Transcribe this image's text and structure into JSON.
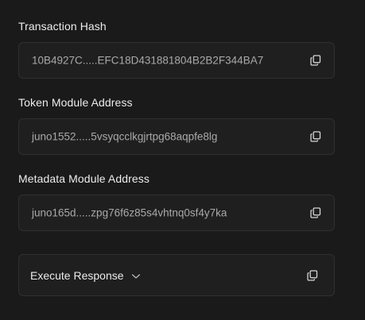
{
  "fields": [
    {
      "label": "Transaction Hash",
      "value": "10B4927C.....EFC18D431881804B2B2F344BA7",
      "copy_icon": "copy-icon"
    },
    {
      "label": "Token Module Address",
      "value": "juno1552.....5vsyqcclkgjrtpg68aqpfe8lg",
      "copy_icon": "copy-icon"
    },
    {
      "label": "Metadata Module Address",
      "value": "juno165d.....zpg76f6z85s4vhtnq0sf4y7ka",
      "copy_icon": "copy-icon"
    }
  ],
  "execute": {
    "label": "Execute Response",
    "chevron_icon": "chevron-down-icon",
    "copy_icon": "copy-icon"
  },
  "colors": {
    "background": "#1a1a1a",
    "field_bg": "#1f1f1f",
    "border": "#303030",
    "label_text": "#ececec",
    "value_text": "#a9a9a9"
  }
}
